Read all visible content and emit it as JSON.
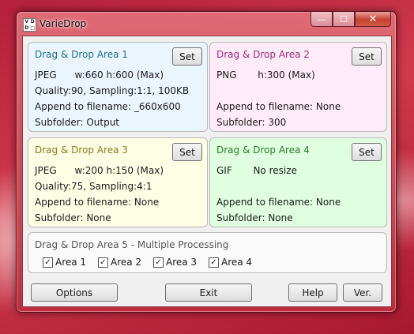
{
  "window": {
    "title": "VarieDrop",
    "icon_letters": [
      "V",
      "D",
      "D",
      "□"
    ]
  },
  "caption": {
    "minimize": "—",
    "maximize": "☐",
    "close": "✕"
  },
  "areas": [
    {
      "header": "Drag & Drop Area 1",
      "set_label": "Set",
      "lines": [
        "JPEG      w:660 h:600 (Max)",
        "Quality:90, Sampling:1:1, 100KB",
        "Append to filename: _660x600",
        "Subfolder: Output"
      ]
    },
    {
      "header": "Drag & Drop Area 2",
      "set_label": "Set",
      "lines": [
        "PNG       h:300 (Max)",
        "",
        "Append to filename: None",
        "Subfolder: 300"
      ]
    },
    {
      "header": "Drag & Drop Area 3",
      "set_label": "Set",
      "lines": [
        "JPEG      w:200 h:150 (Max)",
        "Quality:75, Sampling:4:1",
        "Append to filename: None",
        "Subfolder: None"
      ]
    },
    {
      "header": "Drag & Drop Area 4",
      "set_label": "Set",
      "lines": [
        "GIF       No resize",
        "",
        "Append to filename: None",
        "Subfolder: None"
      ]
    }
  ],
  "multi": {
    "header": "Drag & Drop Area 5 - Multiple Processing",
    "checks": [
      {
        "label": "Area 1",
        "checked": true
      },
      {
        "label": "Area 2",
        "checked": true
      },
      {
        "label": "Area 3",
        "checked": true
      },
      {
        "label": "Area 4",
        "checked": true
      }
    ]
  },
  "buttons": {
    "options": "Options",
    "exit": "Exit",
    "help": "Help",
    "ver": "Ver."
  }
}
